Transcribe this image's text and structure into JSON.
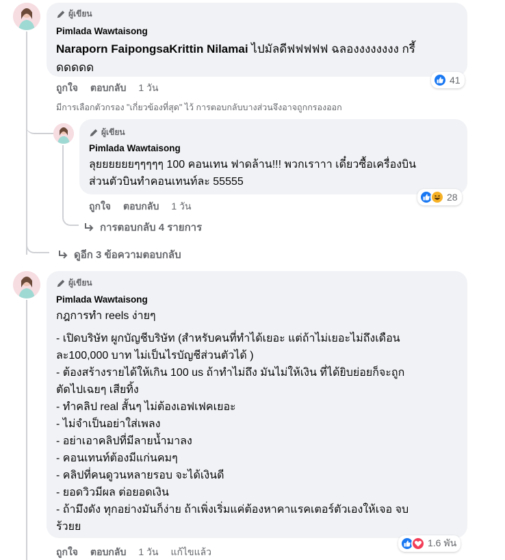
{
  "badge_label": "ผู้เขียน",
  "comments": [
    {
      "author": "Pimlada Wawtaisong",
      "mention": "Naraporn FaipongsaKrittin Nilamai",
      "text_line1_suffix": " ไปมัลดีฟฟฟฟฟ ฉลองงงงงงงง กรี้",
      "text_line2": "ดดดดด",
      "like_label": "ถูกใจ",
      "reply_label": "ตอบกลับ",
      "time": "1 วัน",
      "reaction_count": "41"
    },
    {
      "author": "Pimlada Wawtaisong",
      "text_lines": [
        "ลุยยยยยยๆๆๆๆๆ 100 คอนเทน ฟาดล้าน!!! พวกเราาา เดี๋ยวซื้อเครื่องบิน",
        "ส่วนตัวบินทำคอนเทนท์ละ 55555"
      ],
      "like_label": "ถูกใจ",
      "reply_label": "ตอบกลับ",
      "time": "1 วัน",
      "reaction_count": "28"
    },
    {
      "author": "Pimlada Wawtaisong",
      "text_lines": [
        "กฎการทำ reels ง่ายๆ",
        "",
        "- เปิดบริษัท ผูกบัญชีบริษัท (สำหรับคนที่ทำได้เยอะ แต่ถ้าไม่เยอะไม่ถึงเดือน",
        "ละ100,000 บาท ไม่เป็นไรบัญชีส่วนตัวได้ )",
        "- ต้องสร้างรายได้ให้เกิน 100 us ถ้าทำไม่ถึง มันไม่ให้เงิน ที่ได้ยิบย่อยก็จะถูก",
        "ตัดไปเฉยๆ เสียทิ้ง",
        "- ทำคลิป real สั้นๆ ไม่ต้องเอฟเฟคเยอะ",
        "- ไม่จำเป็นอย่าใส่เพลง",
        "- อย่าเอาคลิปที่มีลายน้ำมาลง",
        "- คอนเทนท์ต้องมีแก่นคมๆ",
        "- คลิปที่คนดูวนหลายรอบ จะได้เงินดี",
        "- ยอดวิวมีผล ต่อยอดเงิน",
        "- ถ้ามึงดัง ทุกอย่างมันก็ง่าย ถ้าเพิ่งเริ่มแค่ต้องหาคาแรคเตอร์ตัวเองให้เจอ จบ",
        "ร้วยย"
      ],
      "like_label": "ถูกใจ",
      "reply_label": "ตอบกลับ",
      "time": "1 วัน",
      "edited_label": "แก้ไขแล้ว",
      "reaction_count": "1.6 พัน"
    }
  ],
  "filter_note": "มีการเลือกตัวกรอง \"เกี่ยวข้องที่สุด\" ไว้ การตอบกลับบางส่วนจึงอาจถูกกรองออก",
  "view_replies_4": "การตอบกลับ 4 รายการ",
  "view_more_replies": "ดูอีก 3 ข้อความตอบกลับ",
  "colors": {
    "bubble": "#f0f2f5",
    "text": "#050505",
    "secondary": "#65676b",
    "like_blue": "#1877f2",
    "love_red": "#f33e58",
    "haha_yellow": "#f7b125"
  },
  "icons": [
    "pen-icon",
    "like-icon",
    "haha-icon",
    "love-icon",
    "reply-arrow-icon"
  ]
}
